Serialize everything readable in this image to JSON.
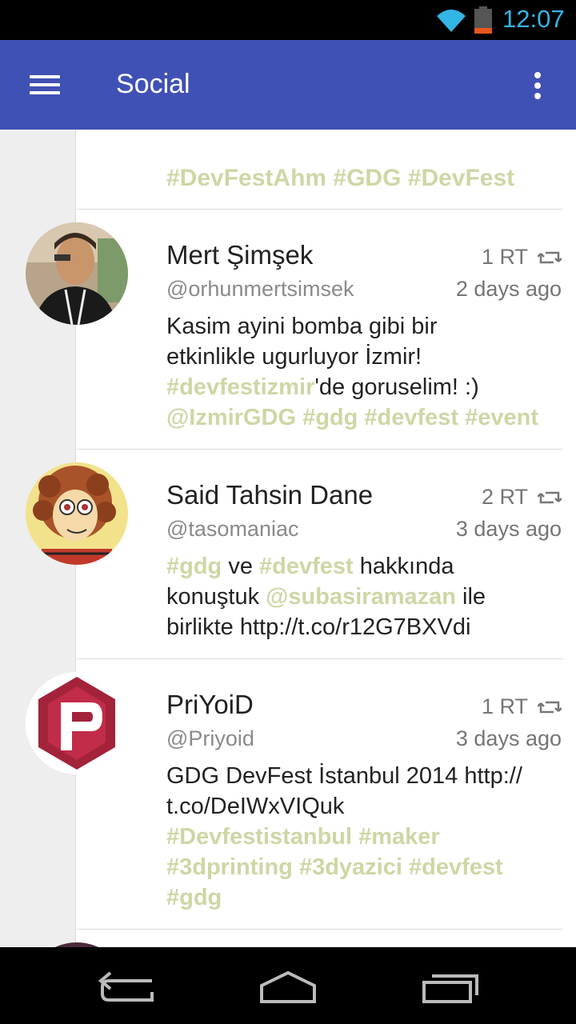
{
  "status_bar": {
    "time": "12:07",
    "wifi_icon": "wifi-icon",
    "battery_icon": "battery-icon"
  },
  "app_bar": {
    "title": "Social",
    "menu_icon": "hamburger-menu-icon",
    "overflow_icon": "more-vert-icon"
  },
  "partial_tweet": {
    "tail_text": "#DevFestAhm #GDG #DevFest"
  },
  "tweets": [
    {
      "name": "Mert Şimşek",
      "handle": "@orhunmertsimsek",
      "rt": "1 RT",
      "time": "2 days ago",
      "lines": [
        {
          "segments": [
            {
              "t": "Kasim ayini bomba gibi bir",
              "tag": false
            }
          ]
        },
        {
          "segments": [
            {
              "t": "etkinlikle ugurluyor İzmir!",
              "tag": false
            }
          ]
        },
        {
          "segments": [
            {
              "t": "#devfestizmir",
              "tag": true
            },
            {
              "t": "'de goruselim! :)",
              "tag": false
            }
          ]
        },
        {
          "segments": [
            {
              "t": "@IzmirGDG #gdg #devfest #event",
              "tag": true
            }
          ]
        }
      ]
    },
    {
      "name": "Said Tahsin Dane",
      "handle": "@tasomaniac",
      "rt": "2 RT",
      "time": "3 days ago",
      "lines": [
        {
          "segments": [
            {
              "t": "#gdg",
              "tag": true
            },
            {
              "t": " ve ",
              "tag": false
            },
            {
              "t": "#devfest",
              "tag": true
            },
            {
              "t": " hakkında",
              "tag": false
            }
          ]
        },
        {
          "segments": [
            {
              "t": "konuştuk ",
              "tag": false
            },
            {
              "t": "@subasiramazan",
              "tag": true
            },
            {
              "t": " ile",
              "tag": false
            }
          ]
        },
        {
          "segments": [
            {
              "t": "birlikte http://t.co/r12G7BXVdi",
              "tag": false
            }
          ]
        }
      ]
    },
    {
      "name": "PriYoiD",
      "handle": "@Priyoid",
      "rt": "1 RT",
      "time": "3 days ago",
      "lines": [
        {
          "segments": [
            {
              "t": "GDG DevFest İstanbul 2014 http://",
              "tag": false
            }
          ]
        },
        {
          "segments": [
            {
              "t": "t.co/DeIWxVIQuk",
              "tag": false
            }
          ]
        },
        {
          "segments": [
            {
              "t": "#Devfestistanbul #maker",
              "tag": true
            }
          ]
        },
        {
          "segments": [
            {
              "t": "#3dprinting #3dyazici #devfest",
              "tag": true
            }
          ]
        },
        {
          "segments": [
            {
              "t": "#gdg",
              "tag": true
            }
          ]
        }
      ]
    }
  ],
  "colors": {
    "app_bar": "#3f51b5",
    "hashtag": "#cfd6a5",
    "clock": "#33b5e5"
  },
  "nav_bar": {
    "back_icon": "back-icon",
    "home_icon": "home-icon",
    "recents_icon": "recents-icon"
  }
}
